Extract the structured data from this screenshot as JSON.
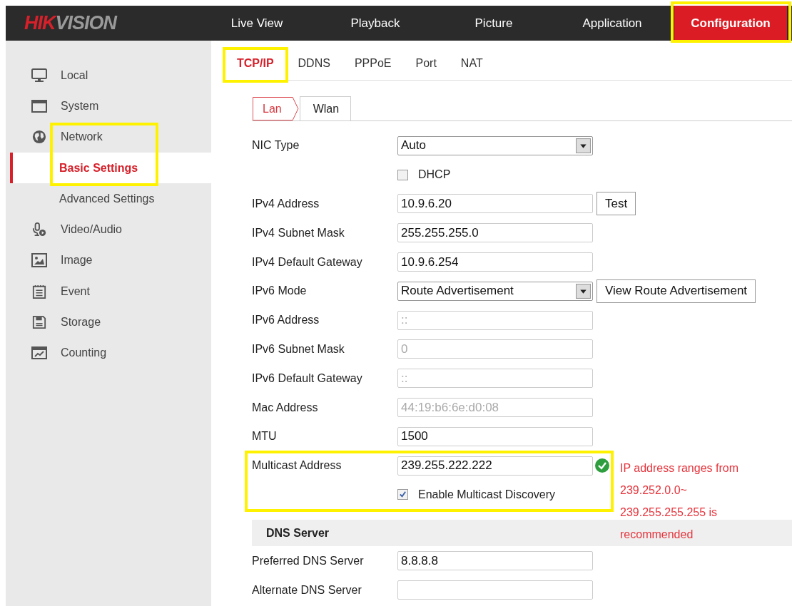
{
  "logo": {
    "mark": "HIK",
    "rest": "VISION"
  },
  "nav": [
    {
      "label": "Live View",
      "selected": false,
      "highlighted": false
    },
    {
      "label": "Playback",
      "selected": false,
      "highlighted": false
    },
    {
      "label": "Picture",
      "selected": false,
      "highlighted": false
    },
    {
      "label": "Application",
      "selected": false,
      "highlighted": false
    },
    {
      "label": "Configuration",
      "selected": true,
      "highlighted": true
    }
  ],
  "sidebar": {
    "items": [
      {
        "label": "Local",
        "highlighted": false
      },
      {
        "label": "System",
        "highlighted": false
      },
      {
        "label": "Network",
        "highlighted": true,
        "children": [
          {
            "label": "Basic Settings",
            "selected": true
          },
          {
            "label": "Advanced Settings",
            "selected": false
          }
        ]
      },
      {
        "label": "Video/Audio",
        "highlighted": false
      },
      {
        "label": "Image",
        "highlighted": false
      },
      {
        "label": "Event",
        "highlighted": false
      },
      {
        "label": "Storage",
        "highlighted": false
      },
      {
        "label": "Counting",
        "highlighted": false
      }
    ]
  },
  "tabs": [
    {
      "label": "TCP/IP",
      "selected": true,
      "highlighted": true
    },
    {
      "label": "DDNS",
      "selected": false,
      "highlighted": false
    },
    {
      "label": "PPPoE",
      "selected": false,
      "highlighted": false
    },
    {
      "label": "Port",
      "selected": false,
      "highlighted": false
    },
    {
      "label": "NAT",
      "selected": false,
      "highlighted": false
    }
  ],
  "subtabs": [
    {
      "label": "Lan",
      "selected": true
    },
    {
      "label": "Wlan",
      "selected": false
    }
  ],
  "form": {
    "rows": [
      {
        "kind": "select",
        "label": "NIC Type",
        "value": "Auto"
      },
      {
        "kind": "checkbox",
        "label": "DHCP",
        "checked": false
      },
      {
        "kind": "text",
        "label": "IPv4 Address",
        "value": "10.9.6.20",
        "disabled": false,
        "button": "Test"
      },
      {
        "kind": "text",
        "label": "IPv4 Subnet Mask",
        "value": "255.255.255.0",
        "disabled": false
      },
      {
        "kind": "text",
        "label": "IPv4 Default Gateway",
        "value": "10.9.6.254",
        "disabled": false
      },
      {
        "kind": "select",
        "label": "IPv6 Mode",
        "value": "Route Advertisement",
        "button": "View Route Advertisement"
      },
      {
        "kind": "text",
        "label": "IPv6 Address",
        "value": "::",
        "disabled": true
      },
      {
        "kind": "text",
        "label": "IPv6 Subnet Mask",
        "value": "0",
        "disabled": true
      },
      {
        "kind": "text",
        "label": "IPv6 Default Gateway",
        "value": "::",
        "disabled": true
      },
      {
        "kind": "text",
        "label": "Mac Address",
        "value": "44:19:b6:6e:d0:08",
        "disabled": true
      },
      {
        "kind": "text",
        "label": "MTU",
        "value": "1500",
        "disabled": false
      },
      {
        "kind": "group",
        "highlighted": true,
        "rows": [
          {
            "kind": "text",
            "label": "Multicast Address",
            "value": "239.255.222.222",
            "disabled": false,
            "valid": true,
            "hint_lines": [
              "IP address ranges from",
              "239.252.0.0~",
              "239.255.255.255 is",
              "recommended"
            ]
          },
          {
            "kind": "checkbox",
            "label": "Enable Multicast Discovery",
            "checked": true
          }
        ]
      },
      {
        "kind": "section",
        "label": "DNS Server"
      },
      {
        "kind": "text",
        "label": "Preferred DNS Server",
        "value": "8.8.8.8",
        "disabled": false
      },
      {
        "kind": "text",
        "label": "Alternate DNS Server"
      }
    ]
  }
}
